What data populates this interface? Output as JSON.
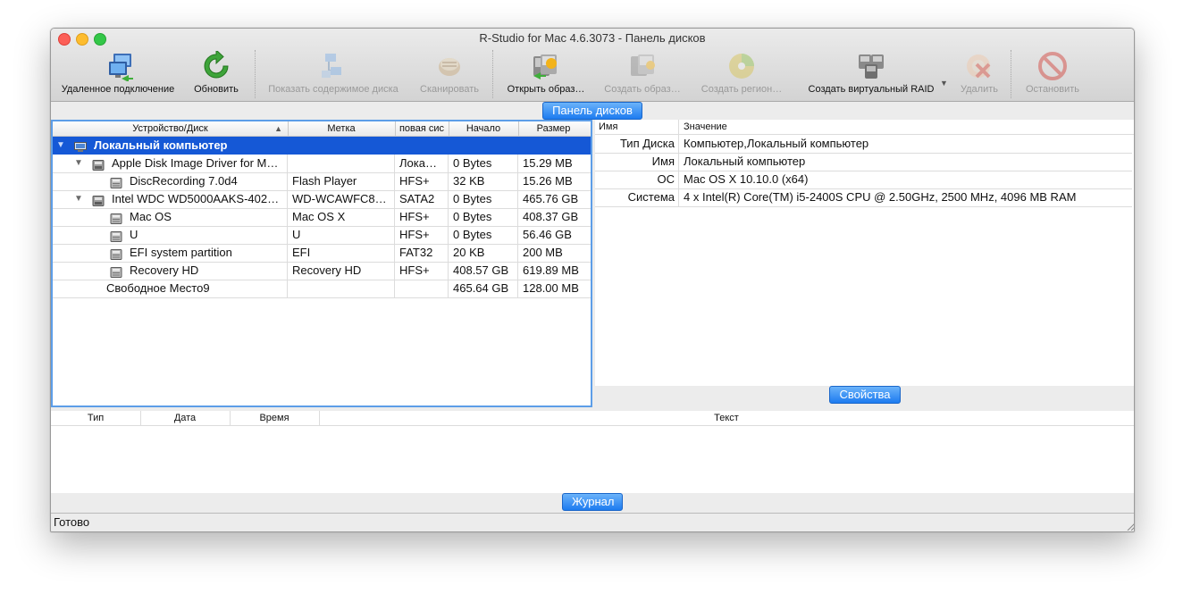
{
  "window": {
    "title": "R-Studio for Mac 4.6.3073 - Панель дисков"
  },
  "toolbar": {
    "buttons": [
      {
        "label": "Удаленное подключение",
        "icon": "remote-connection-icon",
        "enabled": true
      },
      {
        "label": "Обновить",
        "icon": "refresh-icon",
        "enabled": true
      },
      {
        "label": "Показать содержимое диска",
        "icon": "show-disk-contents-icon",
        "enabled": false
      },
      {
        "label": "Сканировать",
        "icon": "scan-icon",
        "enabled": false
      },
      {
        "label": "Открыть образ…",
        "icon": "open-image-icon",
        "enabled": true
      },
      {
        "label": "Создать образ…",
        "icon": "create-image-icon",
        "enabled": false
      },
      {
        "label": "Создать регион…",
        "icon": "create-region-icon",
        "enabled": false
      },
      {
        "label": "Создать виртуальный RAID",
        "icon": "virtual-raid-icon",
        "enabled": true
      },
      {
        "label": "Удалить",
        "icon": "delete-icon",
        "enabled": false
      },
      {
        "label": "Остановить",
        "icon": "stop-icon",
        "enabled": false
      }
    ],
    "raid_dropdown_glyph": "▼"
  },
  "panels": {
    "disks_label": "Панель дисков",
    "properties_label": "Свойства",
    "log_label": "Журнал"
  },
  "tree": {
    "columns": [
      "Устройство/Диск",
      "Метка",
      "повая сис",
      "Начало",
      "Размер"
    ],
    "sort_glyph": "▲",
    "rows": [
      {
        "name": "Локальный компьютер",
        "label": "",
        "fs": "",
        "start": "",
        "size": "",
        "level": 0,
        "expanded": true,
        "icon": "computer-icon",
        "selected": true
      },
      {
        "name": "Apple Disk Image Driver for M…",
        "label": "",
        "fs": "Лока…",
        "start": "0 Bytes",
        "size": "15.29 MB",
        "level": 1,
        "expanded": true,
        "icon": "disk-drive-icon",
        "selected": false
      },
      {
        "name": "DiscRecording 7.0d4",
        "label": "Flash Player",
        "fs": "HFS+",
        "start": "32 KB",
        "size": "15.26 MB",
        "level": 2,
        "expanded": null,
        "icon": "partition-icon",
        "selected": false
      },
      {
        "name": "Intel WDC WD5000AAKS-402…",
        "label": "WD-WCAWFC8…",
        "fs": "SATA2",
        "start": "0 Bytes",
        "size": "465.76 GB",
        "level": 1,
        "expanded": true,
        "icon": "disk-drive-icon",
        "selected": false
      },
      {
        "name": "Mac OS",
        "label": "Mac OS X",
        "fs": "HFS+",
        "start": "0 Bytes",
        "size": "408.37 GB",
        "level": 2,
        "expanded": null,
        "icon": "partition-icon",
        "selected": false
      },
      {
        "name": "U",
        "label": "U",
        "fs": "HFS+",
        "start": "0 Bytes",
        "size": "56.46 GB",
        "level": 2,
        "expanded": null,
        "icon": "partition-icon",
        "selected": false
      },
      {
        "name": "EFI system partition",
        "label": "EFI",
        "fs": "FAT32",
        "start": "20 KB",
        "size": "200 MB",
        "level": 2,
        "expanded": null,
        "icon": "partition-icon",
        "selected": false
      },
      {
        "name": "Recovery HD",
        "label": "Recovery HD",
        "fs": "HFS+",
        "start": "408.57 GB",
        "size": "619.89 MB",
        "level": 2,
        "expanded": null,
        "icon": "partition-icon",
        "selected": false
      },
      {
        "name": "Свободное Место9",
        "label": "",
        "fs": "",
        "start": "465.64 GB",
        "size": "128.00 MB",
        "level": 2,
        "expanded": null,
        "icon": "",
        "selected": false
      }
    ]
  },
  "properties": {
    "columns": [
      "Имя",
      "Значение"
    ],
    "rows": [
      {
        "name": "Тип Диска",
        "value": "Компьютер,Локальный компьютер"
      },
      {
        "name": "Имя",
        "value": "Локальный компьютер"
      },
      {
        "name": "ОС",
        "value": "Mac OS X 10.10.0 (x64)"
      },
      {
        "name": "Система",
        "value": "4 x Intel(R) Core(TM) i5-2400S CPU @ 2.50GHz, 2500 MHz, 4096 MB RAM"
      }
    ]
  },
  "log": {
    "columns": [
      "Тип",
      "Дата",
      "Время",
      "Текст"
    ]
  },
  "status": {
    "text": "Готово"
  },
  "colors": {
    "accent": "#1558d6",
    "pill": "#1d7bf0",
    "focus_border": "#5d9ee8"
  }
}
